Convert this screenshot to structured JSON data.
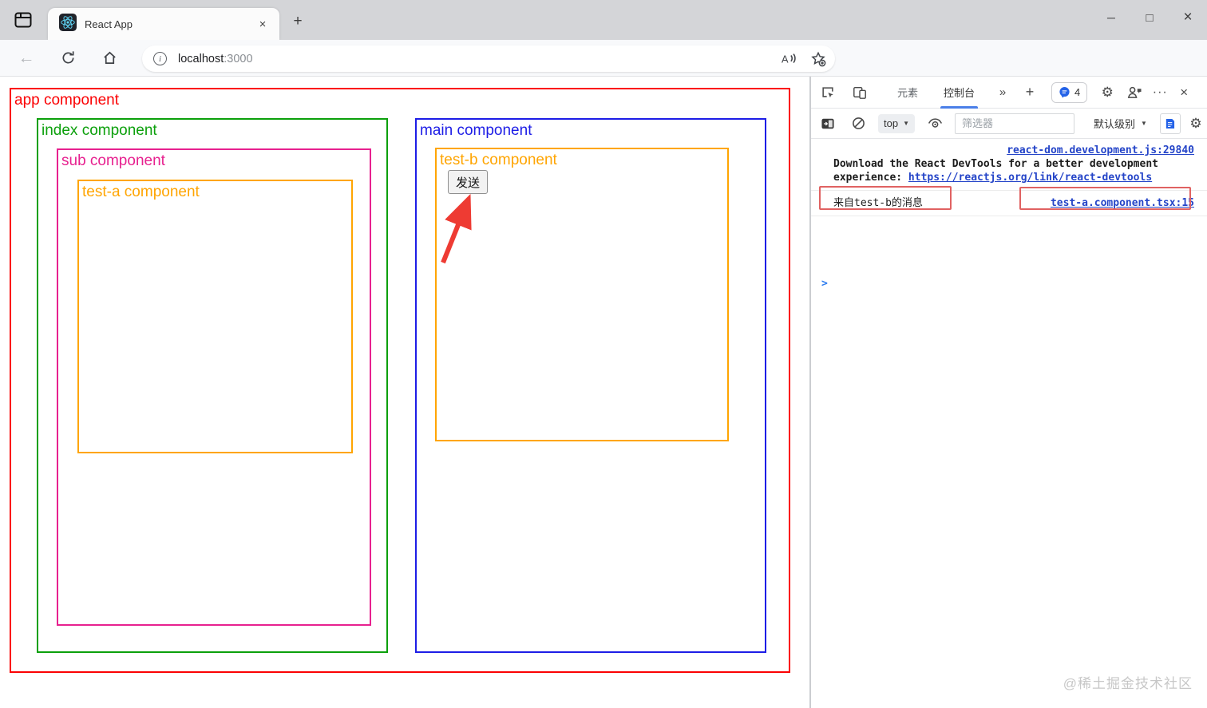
{
  "titlebar": {
    "tab_title": "React App"
  },
  "navbar": {
    "url_host": "localhost",
    "url_port": ":3000"
  },
  "page": {
    "components": [
      {
        "label": "app component",
        "color_key": "app"
      },
      {
        "label": "index component",
        "color_key": "index"
      },
      {
        "label": "sub component",
        "color_key": "sub"
      },
      {
        "label": "test-a component",
        "color_key": "testa"
      },
      {
        "label": "main component",
        "color_key": "main"
      },
      {
        "label": "test-b component",
        "color_key": "testb"
      }
    ],
    "send_button": "发送"
  },
  "devtools": {
    "toolbar": {
      "tab_elements": "元素",
      "tab_console": "控制台",
      "badge_count": "4"
    },
    "console_bar": {
      "context": "top",
      "filter_placeholder": "筛选器",
      "level": "默认级别"
    },
    "console": {
      "entry1": {
        "source": "react-dom.development.js:29840",
        "line1": "Download the React DevTools for a better development",
        "line2_prefix": "experience: ",
        "line2_link": "https://reactjs.org/link/react-devtools"
      },
      "entry2": {
        "message": "来自test-b的消息",
        "source": "test-a.component.tsx:15"
      }
    }
  },
  "watermark": "@稀土掘金技术社区",
  "colors": {
    "app": "#fb0204",
    "index": "#0ca00c",
    "sub": "#e7218f",
    "testa": "#ffa502",
    "main": "#1d1de6",
    "testb": "#ffa502",
    "annotation": "#e06262",
    "arrow": "#ee3b33",
    "link": "#2444c8",
    "accent": "#4a7fe8"
  }
}
